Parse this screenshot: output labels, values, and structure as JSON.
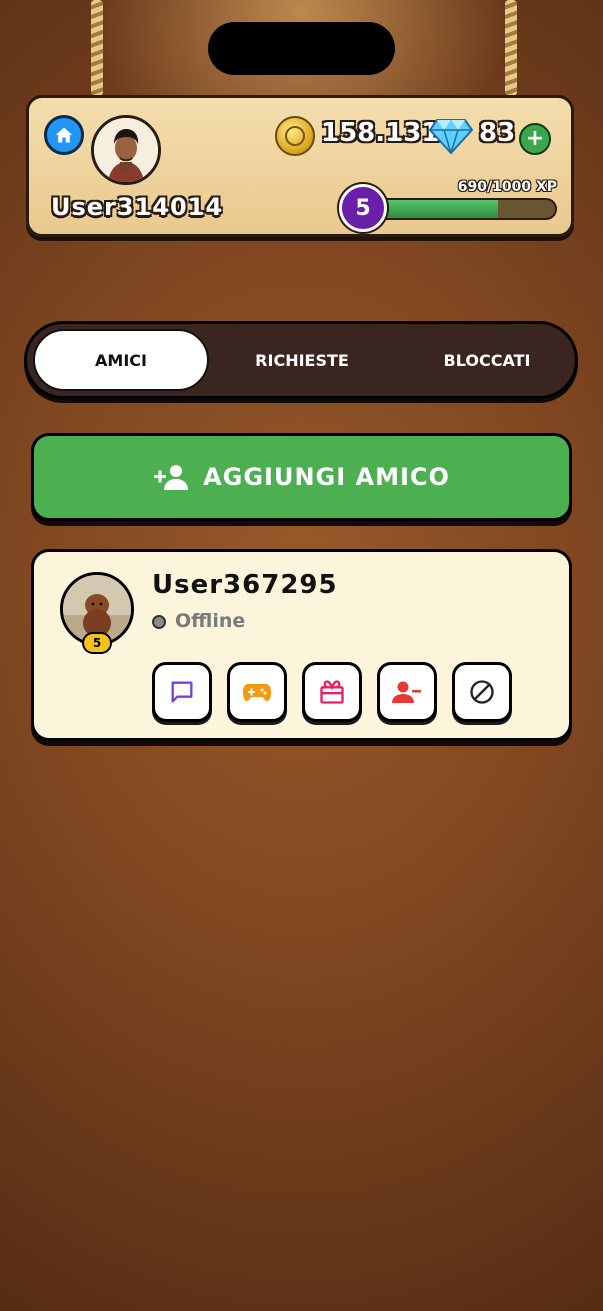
{
  "header": {
    "username": "User314014",
    "coins": "158.131",
    "gems": "83",
    "plus_label": "+",
    "xp_text": "690/1000 XP",
    "xp_progress": 0.69,
    "level": "5"
  },
  "tabs": [
    {
      "label": "AMICI",
      "active": true
    },
    {
      "label": "RICHIESTE",
      "active": false
    },
    {
      "label": "BLOCCATI",
      "active": false
    }
  ],
  "add_friend": {
    "label": "AGGIUNGI AMICO",
    "icon": "add-person-icon"
  },
  "friends": [
    {
      "name": "User367295",
      "status": "Offline",
      "level": "5",
      "actions": [
        "chat-icon",
        "gamepad-icon",
        "gift-icon",
        "remove-friend-icon",
        "block-icon"
      ]
    }
  ],
  "colors": {
    "accent_green": "#4caf50",
    "home_blue": "#2196f3",
    "level_purple": "#6a1fa8",
    "chat_purple": "#7b3fe0",
    "gamepad_orange": "#f59a10",
    "gift_pink": "#e91e63",
    "remove_red": "#e53935"
  }
}
